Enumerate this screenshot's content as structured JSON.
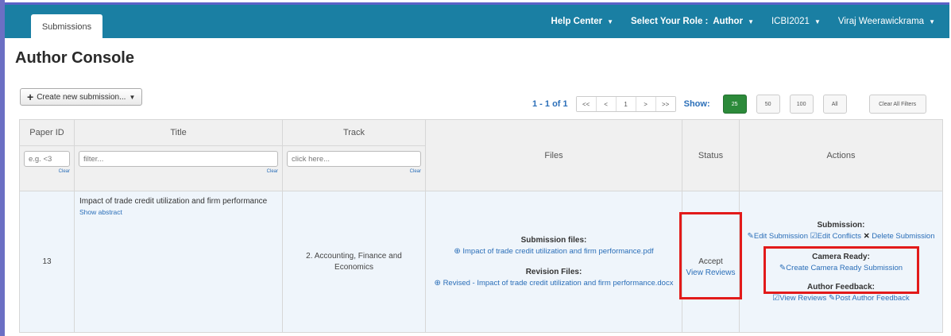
{
  "nav": {
    "tab": "Submissions",
    "help_center": "Help Center",
    "role_label": "Select Your Role :",
    "role_value": "Author",
    "conference": "ICBI2021",
    "user": "Viraj Weerawickrama"
  },
  "page": {
    "title": "Author Console"
  },
  "toolbar": {
    "create_label": "Create new submission..."
  },
  "pager": {
    "range": "1 - 1 of 1",
    "first": "<<",
    "prev": "<",
    "current": "1",
    "next": ">",
    "last": ">>",
    "show_label": "Show:",
    "sizes": [
      "25",
      "50",
      "100",
      "All"
    ],
    "active_size": "25",
    "clear_filters": "Clear All Filters"
  },
  "table": {
    "headers": {
      "paper_id": "Paper ID",
      "title": "Title",
      "track": "Track",
      "files": "Files",
      "status": "Status",
      "actions": "Actions"
    },
    "filters": {
      "paper_id_placeholder": "e.g. <3",
      "title_placeholder": "filter...",
      "track_placeholder": "click here...",
      "clear": "Clear"
    },
    "row": {
      "paper_id": "13",
      "title": "Impact of trade credit utilization and firm performance",
      "show_abstract": "Show abstract",
      "track": "2. Accounting, Finance and Economics",
      "submission_files_label": "Submission files:",
      "submission_file": "Impact of trade credit utilization and firm performance.pdf",
      "revision_files_label": "Revision Files:",
      "revision_file": "Revised - Impact of trade credit utilization and firm performance.docx",
      "status": "Accept",
      "view_reviews_link": "View Reviews",
      "actions": {
        "submission_label": "Submission:",
        "edit_submission": "Edit Submission",
        "edit_conflicts": "Edit Conflicts",
        "delete_submission": "Delete Submission",
        "camera_ready_label": "Camera Ready:",
        "create_camera_ready": "Create Camera Ready Submission",
        "author_feedback_label": "Author Feedback:",
        "view_reviews": "View Reviews",
        "post_author_feedback": "Post Author Feedback"
      }
    }
  },
  "colors": {
    "topbar": "#1a7fa3",
    "link": "#2a6eb8",
    "highlight": "#e21a1a",
    "active_size": "#2c8a3a"
  }
}
